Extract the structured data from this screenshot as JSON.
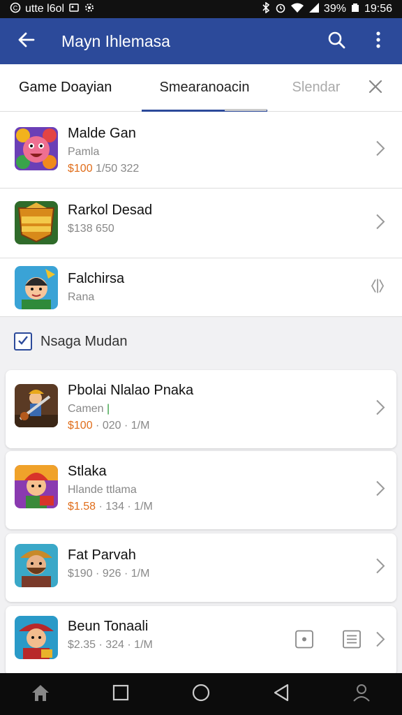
{
  "status_bar": {
    "left_text": "utte l6ol",
    "battery": "39%",
    "time": "19:56"
  },
  "app_bar": {
    "title": "Mayn Ihlemasa"
  },
  "tabs": [
    {
      "label": "Game Doayian"
    },
    {
      "label": "Smearanoacin"
    },
    {
      "label": "Slendar"
    }
  ],
  "top_list": [
    {
      "name": "Malde Gan",
      "sub": "Pamla",
      "price": "$100",
      "meta": " 1/50  322",
      "icon": "fruit-face-icon"
    },
    {
      "name": "Rarkol Desad",
      "sub": "",
      "price": "",
      "meta": "$138  650",
      "icon": "malhit-shield-icon"
    },
    {
      "name": "Falchirsa",
      "sub": "Rana",
      "price": "",
      "meta": "",
      "icon": "boy-avatar-icon"
    }
  ],
  "section": {
    "title": "Nsaga Mudan",
    "checked": true
  },
  "cards": [
    {
      "name": "Pbolai  Nlalao Pnaka",
      "sub": "Camen",
      "price": "$100",
      "meta": " · 020 · 1/M",
      "icon": "guitar-warrior-icon"
    },
    {
      "name": "Stlaka",
      "sub": "Hlande ttlama",
      "price": "$1.58",
      "meta": " · 134 · 1/M",
      "icon": "red-hat-man-icon"
    },
    {
      "name": "Fat Parvah",
      "sub": "",
      "price": "",
      "meta": "$190 · 926 · 1/M",
      "icon": "bearded-man-icon"
    },
    {
      "name": "Beun Tonaali",
      "sub": "",
      "price": "",
      "meta": "$2.35 · 324 · 1/M",
      "icon": "pirate-man-icon"
    }
  ],
  "colors": {
    "primary": "#2c4a9a",
    "price": "#e06d1a",
    "accent_green": "#2e9b3a"
  }
}
